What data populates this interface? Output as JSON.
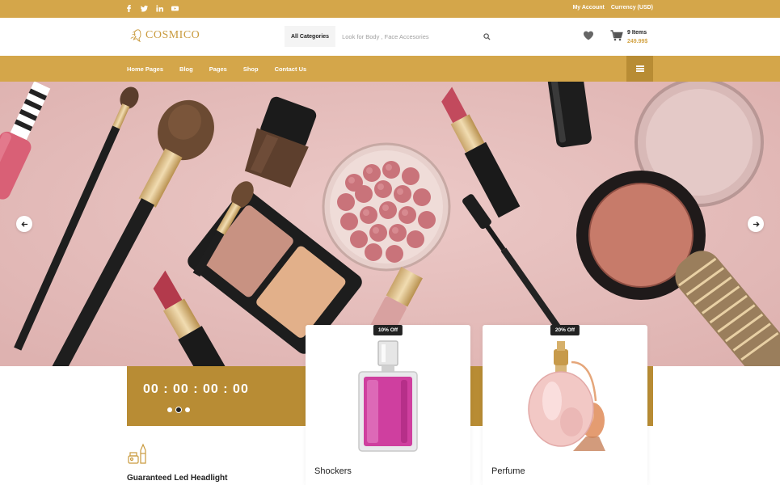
{
  "top_bar": {
    "social_icons": [
      "facebook-icon",
      "twitter-icon",
      "linkedin-icon",
      "youtube-icon"
    ],
    "my_account": "My Account",
    "currency": "Currency (USD)"
  },
  "header": {
    "logo_text": "COSMICO",
    "search": {
      "category_label": "All Categories",
      "placeholder": "Look for Body , Face Accesories"
    },
    "cart": {
      "items": "9 Items",
      "total": "249.99$"
    }
  },
  "nav": {
    "items": [
      "Home Pages",
      "Blog",
      "Pages",
      "Shop",
      "Contact Us"
    ]
  },
  "countdown": {
    "time": "00 : 00 : 00 : 00"
  },
  "feature": {
    "title": "Guaranteed Led Headlight"
  },
  "products": [
    {
      "badge": "10% Off",
      "name": "Shockers"
    },
    {
      "badge": "20% Off",
      "name": "Perfume"
    }
  ],
  "colors": {
    "accent": "#d4a64a",
    "accent_dark": "#b88c34",
    "hero_bg": "#e8c4c2"
  }
}
